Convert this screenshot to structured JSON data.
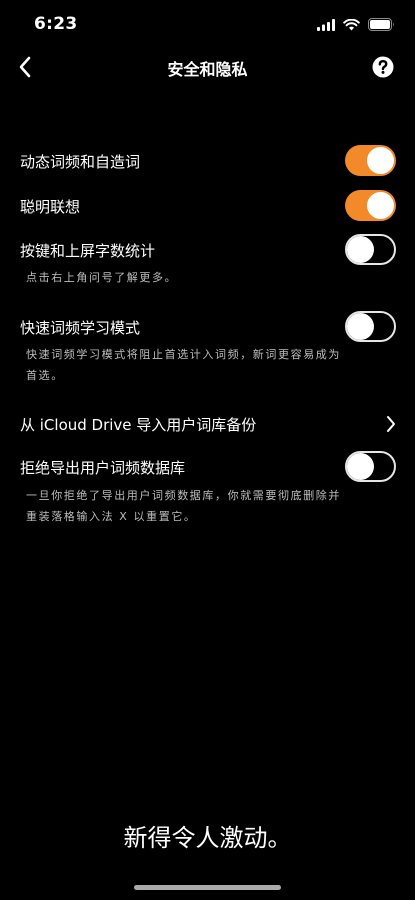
{
  "status": {
    "time": "6:23"
  },
  "nav": {
    "title": "安全和隐私"
  },
  "settings": [
    {
      "label": "动态词频和自造词",
      "on": true
    },
    {
      "label": "聪明联想",
      "on": true
    },
    {
      "label": "按键和上屏字数统计",
      "on": false,
      "description": "点击右上角问号了解更多。"
    },
    {
      "label": "快速词频学习模式",
      "on": false,
      "description_lines": [
        "快速词频学习模式将阻止首选计入词频，新词更容易成为",
        "首选。"
      ]
    },
    {
      "label": "从 iCloud Drive 导入用户词库备份"
    },
    {
      "label": "拒绝导出用户词频数据库",
      "on": false,
      "description_lines": [
        "一旦你拒绝了导出用户词频数据库，你就需要彻底删除并",
        "重装落格输入法 X 以重置它。"
      ]
    }
  ],
  "footer": {
    "tagline": "新得令人激动。"
  },
  "colors": {
    "accent": "#f28a2a",
    "background": "#000000"
  }
}
